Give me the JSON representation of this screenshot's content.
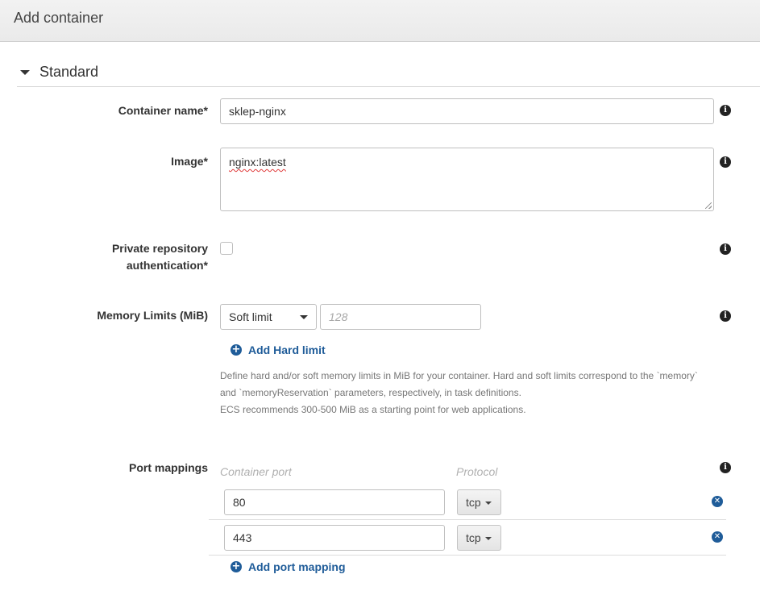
{
  "header": {
    "title": "Add container"
  },
  "section": {
    "title": "Standard"
  },
  "fields": {
    "container_name": {
      "label": "Container name*",
      "value": "sklep-nginx"
    },
    "image": {
      "label": "Image*",
      "value": "nginx:latest"
    },
    "private_repo": {
      "label_line1": "Private repository",
      "label_line2": "authentication*",
      "checked": false
    },
    "memory": {
      "label": "Memory Limits (MiB)",
      "limit_type": "Soft limit",
      "placeholder": "128",
      "add_hard_limit": "Add Hard limit",
      "help_lines": [
        "Define hard and/or soft memory limits in MiB for your container. Hard and soft limits correspond to the `memory`",
        "and `memoryReservation` parameters, respectively, in task definitions.",
        "ECS recommends 300-500 MiB as a starting point for web applications."
      ]
    },
    "port_mappings": {
      "label": "Port mappings",
      "col_container_port": "Container port",
      "col_protocol": "Protocol",
      "rows": [
        {
          "port": "80",
          "protocol": "tcp"
        },
        {
          "port": "443",
          "protocol": "tcp"
        }
      ],
      "add_label": "Add port mapping"
    }
  },
  "icons": {
    "info": "info-icon",
    "plus": "plus-circle-icon",
    "remove": "remove-circle-icon",
    "collapse": "caret-down-icon"
  },
  "colors": {
    "link": "#1f5c99",
    "spellcheck": "#e03b3b"
  }
}
